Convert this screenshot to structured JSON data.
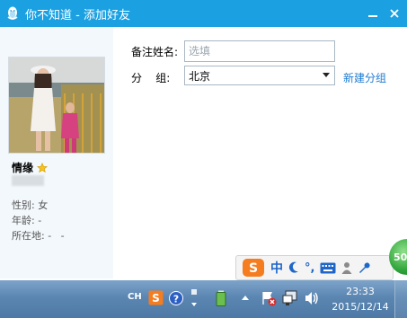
{
  "window": {
    "title": "你不知道 - 添加好友",
    "minimize_label": "—",
    "close_label": "✕"
  },
  "profile": {
    "nickname": "情缘",
    "gender": "性别: 女",
    "age": "年龄: -",
    "location": "所在地: -   -"
  },
  "form": {
    "remark_label": "备注姓名:",
    "remark_placeholder": "选填",
    "remark_value": "",
    "group_label": "分    组:",
    "group_value": "北京",
    "new_group_label": "新建分组"
  },
  "ime": {
    "lang": "中",
    "punct": "°,"
  },
  "ball_badge": "50",
  "taskbar": {
    "input_lang": "CH",
    "time": "23:33",
    "date": "2015/12/14"
  },
  "colors": {
    "titlebar": "#1ba1e2",
    "link": "#1d7bd1",
    "taskbar": "#5b86b2"
  }
}
